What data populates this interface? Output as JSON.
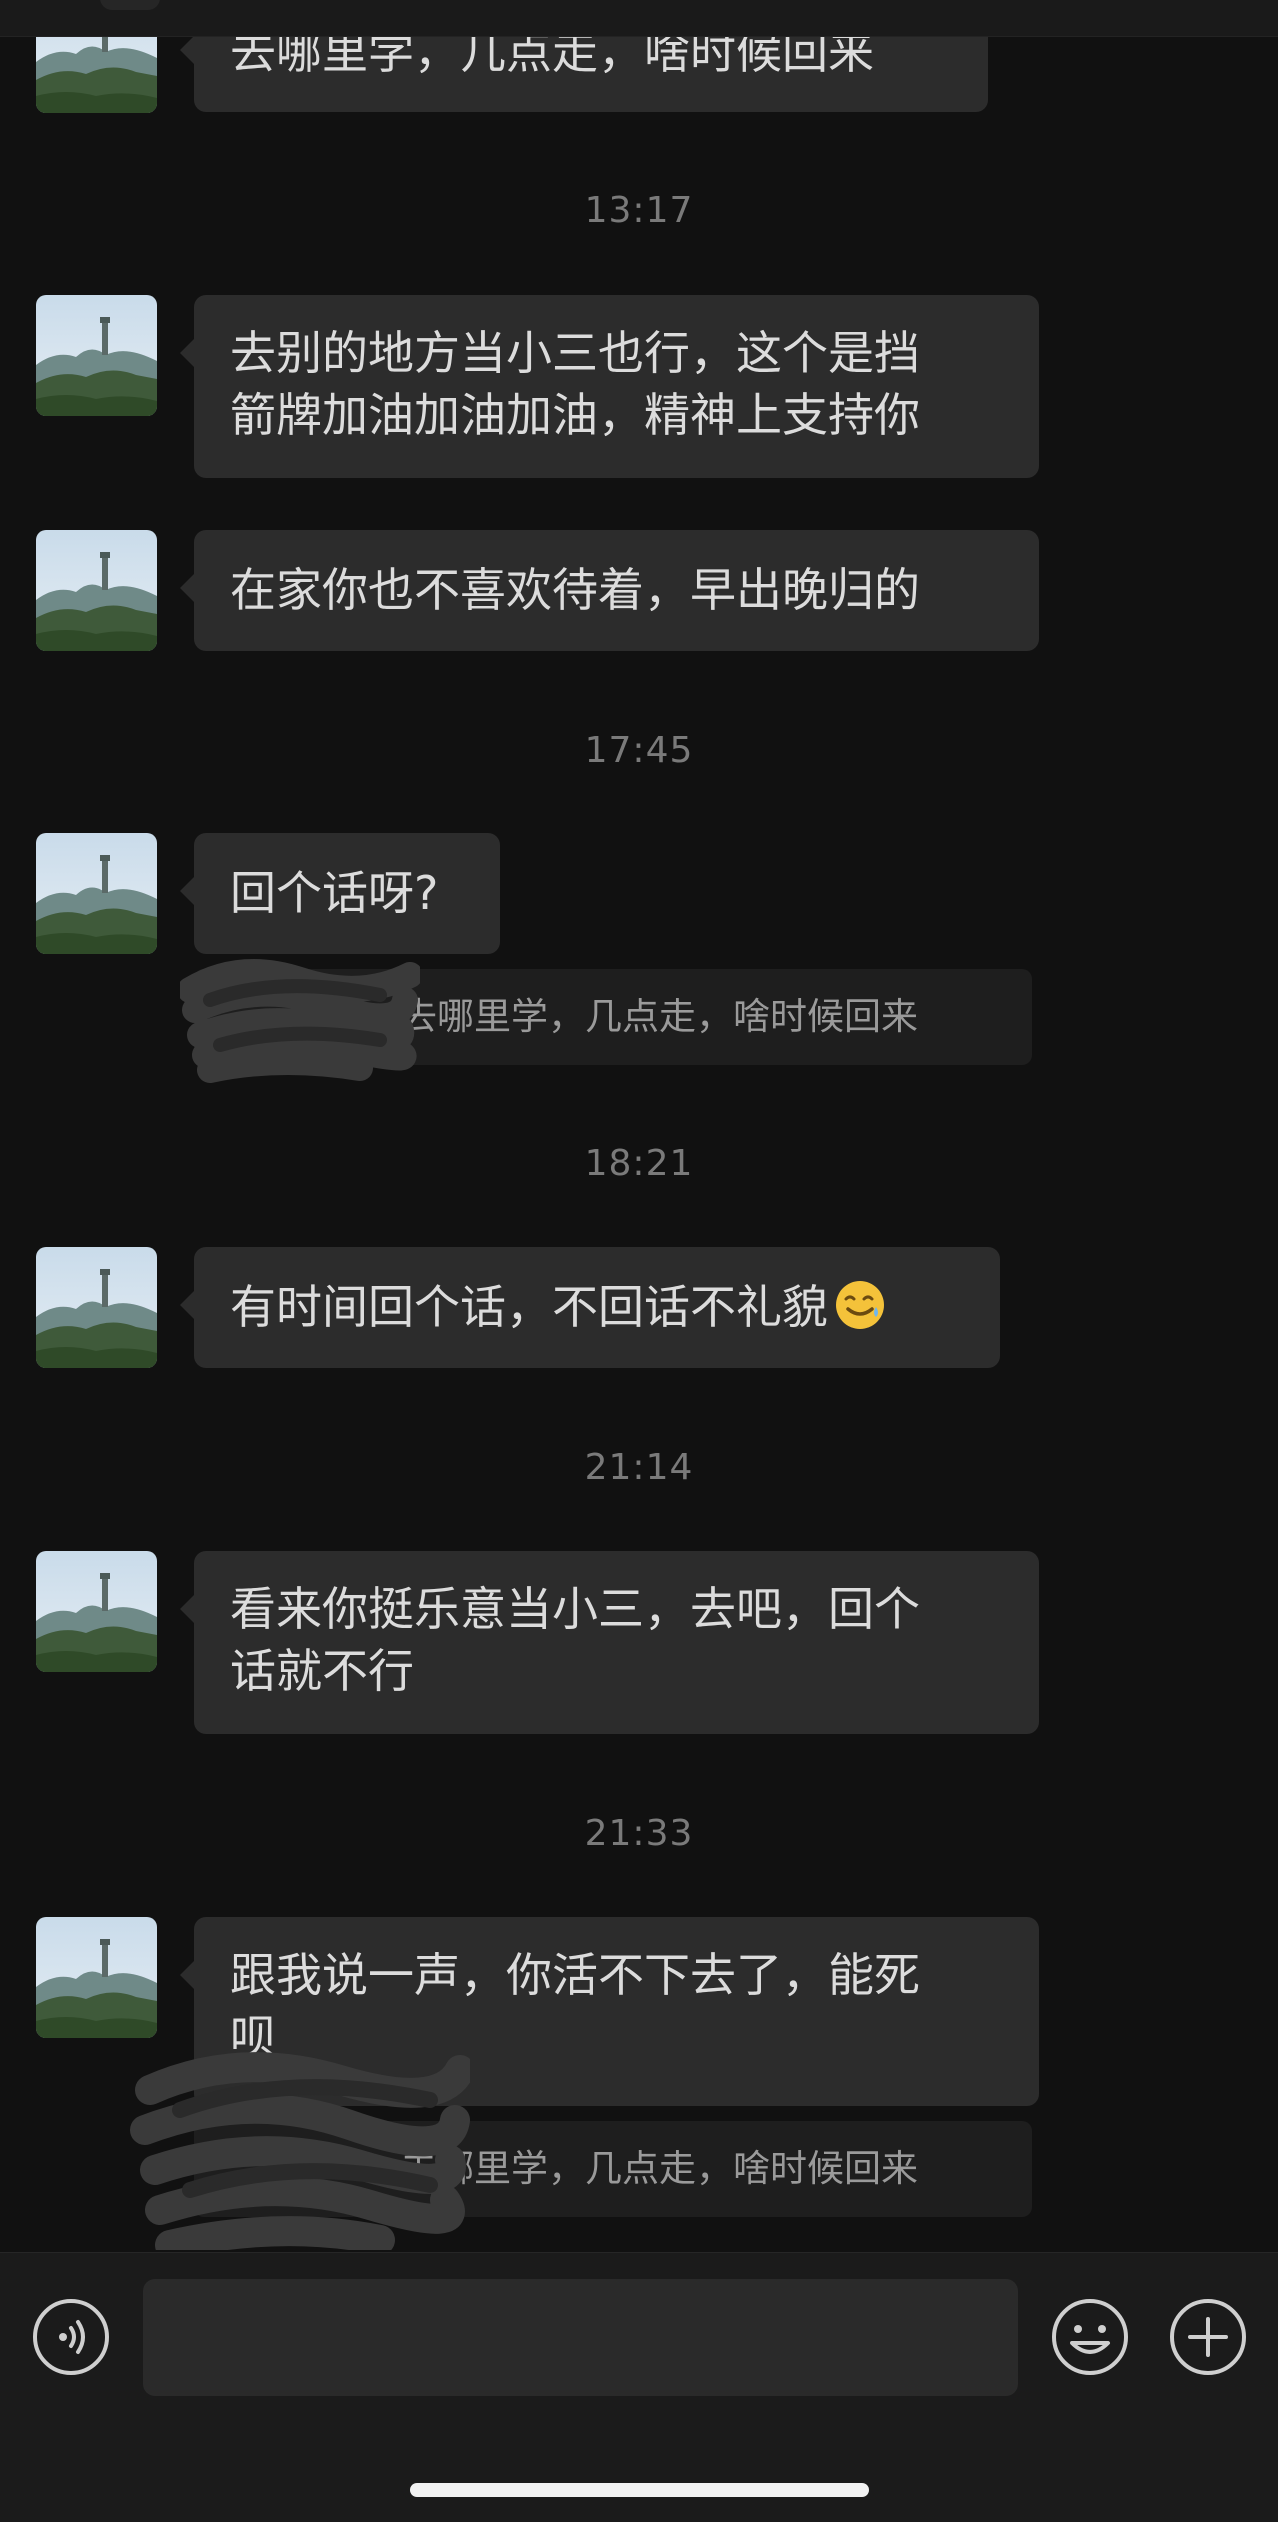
{
  "messages": [
    {
      "text_lines": [
        "去哪里学，几点走，啥时候回来"
      ]
    },
    {
      "text_lines": [
        "去别的地方当小三也行，这个是挡",
        "箭牌加油加油加油，精神上支持你"
      ]
    },
    {
      "text_lines": [
        "在家你也不喜欢待着，早出晚归的"
      ]
    },
    {
      "text_lines": [
        "回个话呀?"
      ]
    },
    {
      "text_lines": [
        "有时间回个话，不回话不礼貌"
      ],
      "emoji": "sweat-smile-emoji"
    },
    {
      "text_lines": [
        "看来你挺乐意当小三，去吧，回个",
        "话就不行"
      ]
    },
    {
      "text_lines": [
        "跟我说一声，你活不下去了，能死",
        "呗"
      ]
    }
  ],
  "timestamps": [
    "13:17",
    "17:45",
    "18:21",
    "21:14",
    "21:33"
  ],
  "quotes": [
    "去哪里学，几点走，啥时候回来",
    "去哪里学，几点走，啥时候回来"
  ],
  "input": {
    "value": "",
    "placeholder": ""
  },
  "icons": {
    "voice": "voice-icon",
    "emoji": "emoji-face-icon",
    "plus": "plus-icon"
  },
  "colors": {
    "background": "#111111",
    "bubble": "#2c2c2c",
    "quote": "#1e1e1e",
    "text": "#dcdcdc",
    "timestamp": "#7a7a7a"
  }
}
